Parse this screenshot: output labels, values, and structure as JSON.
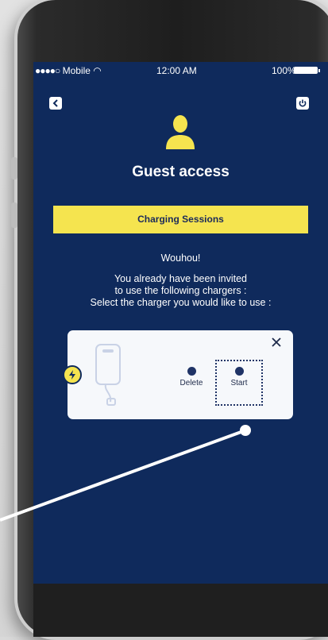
{
  "status_bar": {
    "carrier": "Mobile",
    "time": "12:00 AM",
    "battery": "100%"
  },
  "header": {
    "title": "Guest access"
  },
  "banner": {
    "label": "Charging Sessions"
  },
  "message": {
    "greeting": "Wouhou!",
    "line1": "You already have been invited",
    "line2": "to use the following chargers :",
    "line3": "Select the charger you would like to use :"
  },
  "charger_card": {
    "delete_label": "Delete",
    "start_label": "Start"
  },
  "colors": {
    "screen_bg": "#0f2a5c",
    "accent_yellow": "#f5e44f",
    "card_bg": "#f6f8fb"
  }
}
